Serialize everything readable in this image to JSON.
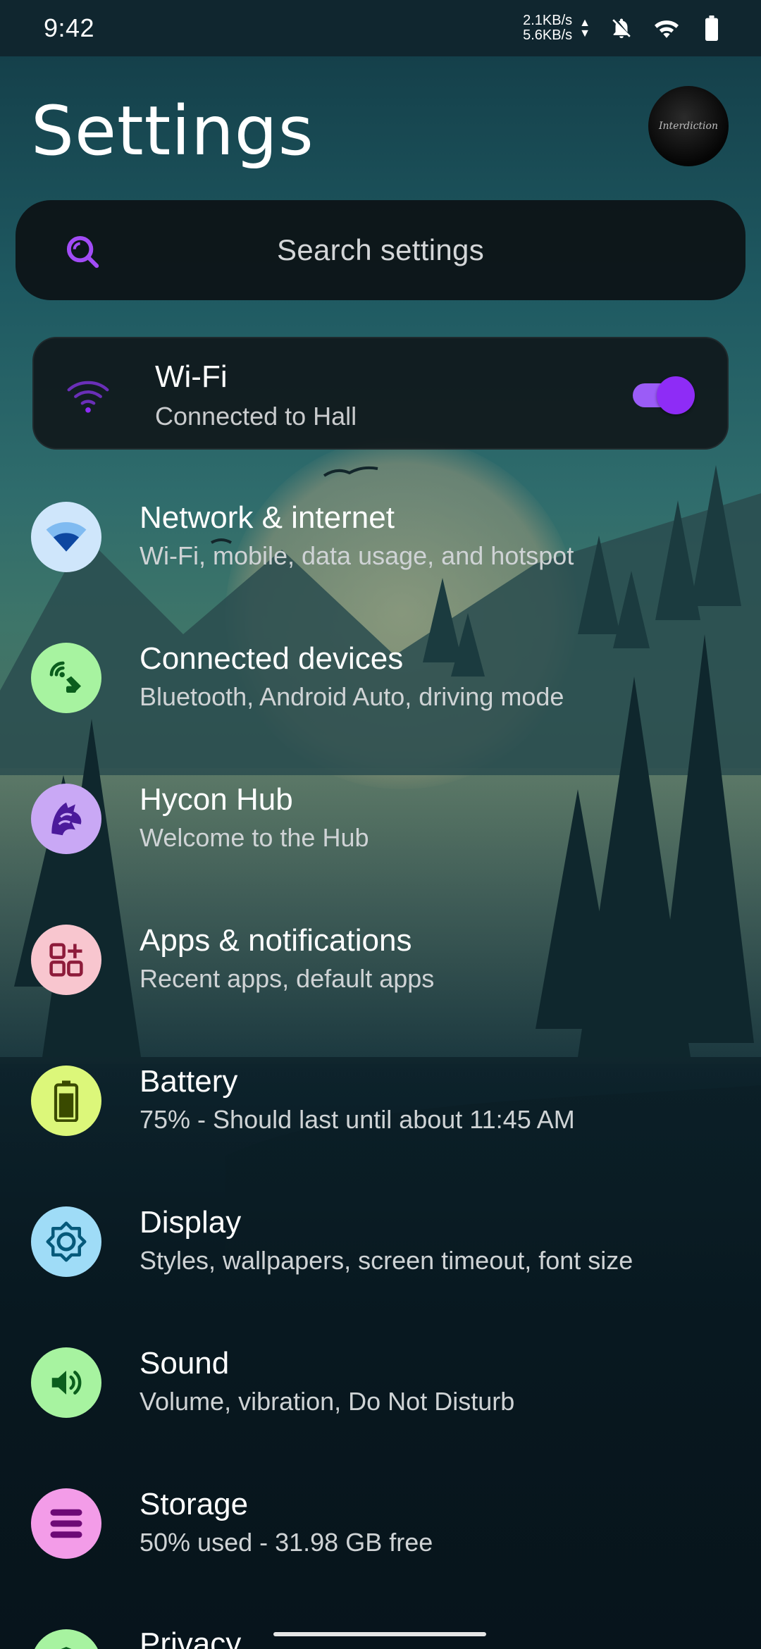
{
  "status_bar": {
    "time": "9:42",
    "upload_speed": "2.1KB/s",
    "download_speed": "5.6KB/s",
    "icons": [
      "bell-off-icon",
      "wifi-icon",
      "battery-icon"
    ]
  },
  "header": {
    "title": "Settings",
    "avatar_text": "Interdiction"
  },
  "search": {
    "placeholder": "Search settings",
    "icon": "search-icon"
  },
  "wifi_card": {
    "title": "Wi-Fi",
    "subtitle": "Connected to Hall",
    "toggle_on": true,
    "accent_color": "#8e2cf6"
  },
  "settings": [
    {
      "label": "Network & internet",
      "subtitle": "Wi-Fi, mobile, data usage, and hotspot",
      "icon": "wifi-icon",
      "bg": "#cfe6fb",
      "fg": "#1565c0"
    },
    {
      "label": "Connected devices",
      "subtitle": "Bluetooth, Android Auto, driving mode",
      "icon": "connected-devices-icon",
      "bg": "#a7f3a0",
      "fg": "#0b5e1d"
    },
    {
      "label": "Hycon Hub",
      "subtitle": "Welcome to the Hub",
      "icon": "wolf-icon",
      "bg": "#c9a8f5",
      "fg": "#4b1a9b"
    },
    {
      "label": "Apps & notifications",
      "subtitle": "Recent apps, default apps",
      "icon": "apps-icon",
      "bg": "#f8c6cf",
      "fg": "#8d1b3a"
    },
    {
      "label": "Battery",
      "subtitle": "75% - Should last until about 11:45 AM",
      "icon": "battery-icon",
      "bg": "#dcf77a",
      "fg": "#3a4a00"
    },
    {
      "label": "Display",
      "subtitle": "Styles, wallpapers, screen timeout, font size",
      "icon": "brightness-icon",
      "bg": "#9fdcf7",
      "fg": "#05597a"
    },
    {
      "label": "Sound",
      "subtitle": "Volume, vibration, Do Not Disturb",
      "icon": "volume-icon",
      "bg": "#a7f3a0",
      "fg": "#0b5e1d"
    },
    {
      "label": "Storage",
      "subtitle": "50% used - 31.98 GB free",
      "icon": "storage-icon",
      "bg": "#f39ce8",
      "fg": "#6d0a76"
    },
    {
      "label": "Privacy",
      "subtitle": "",
      "icon": "shield-icon",
      "bg": "#a7f3a0",
      "fg": "#0b5e1d"
    }
  ]
}
